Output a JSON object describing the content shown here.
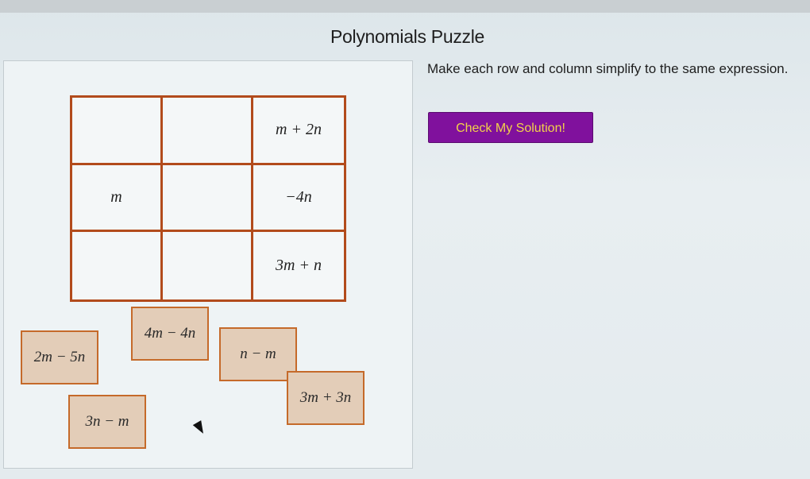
{
  "page": {
    "title": "Polynomials Puzzle",
    "instructions": "Make each row and column simplify to the same expression.",
    "check_button": "Check My Solution!"
  },
  "grid": {
    "cells": [
      [
        "",
        "",
        "m + 2n"
      ],
      [
        "m",
        "",
        "−4n"
      ],
      [
        "",
        "",
        "3m + n"
      ]
    ]
  },
  "tiles": [
    {
      "label": "4m − 4n"
    },
    {
      "label": "2m − 5n"
    },
    {
      "label": "n − m"
    },
    {
      "label": "3m + 3n"
    },
    {
      "label": "3n − m"
    }
  ],
  "colors": {
    "button_bg": "#80119d",
    "button_text": "#f2d24a",
    "grid_border": "#b24b1c",
    "tile_bg": "#e3cdb8",
    "tile_border": "#c56a2a"
  },
  "icons": {
    "cursor": "mouse-pointer-icon"
  }
}
